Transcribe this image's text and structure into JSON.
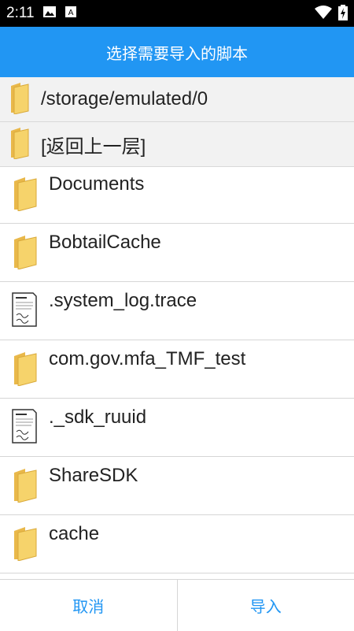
{
  "status": {
    "time": "2:11"
  },
  "title": "选择需要导入的脚本",
  "path_rows": [
    {
      "label": "/storage/emulated/0",
      "icon": "folder-icon"
    },
    {
      "label": "[返回上一层]",
      "icon": "folder-icon"
    }
  ],
  "items": [
    {
      "name": "Documents",
      "icon": "folder-icon"
    },
    {
      "name": "BobtailCache",
      "icon": "folder-icon"
    },
    {
      "name": ".system_log.trace",
      "icon": "document-icon"
    },
    {
      "name": "com.gov.mfa_TMF_test",
      "icon": "folder-icon"
    },
    {
      "name": "._sdk_ruuid",
      "icon": "document-icon"
    },
    {
      "name": "ShareSDK",
      "icon": "folder-icon"
    },
    {
      "name": "cache",
      "icon": "folder-icon"
    }
  ],
  "buttons": {
    "cancel": "取消",
    "import": "导入"
  },
  "colors": {
    "accent": "#2196F3",
    "folder": "#F2CB5B"
  }
}
